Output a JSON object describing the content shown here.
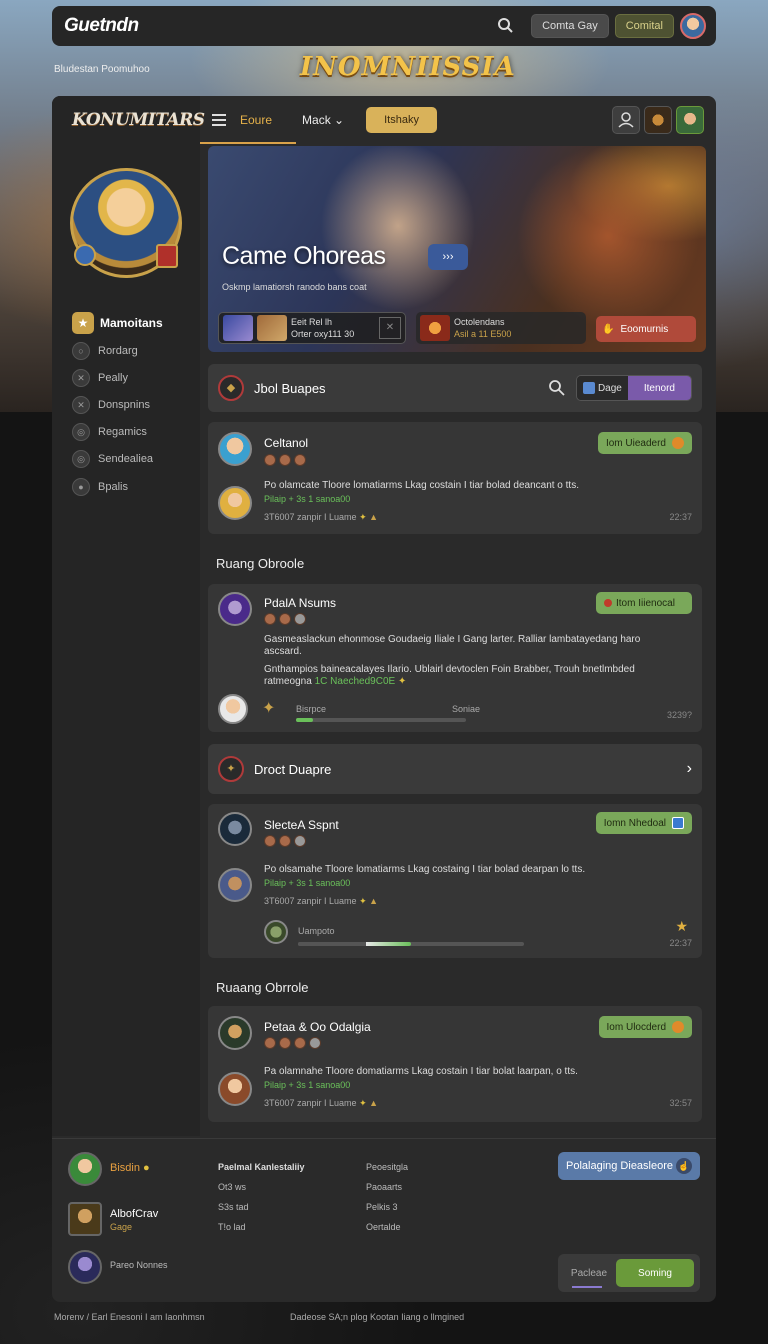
{
  "topbar": {
    "logo": "Guetndn",
    "btn1": "Comta Gay",
    "btn2": "Comital"
  },
  "banner": {
    "subtitle": "Bludestan Poomuhoo",
    "game_title": "INOMNIISSIA"
  },
  "sidebar": {
    "logo": "KONUMITARS",
    "header": "Mamoitans",
    "items": [
      {
        "label": "Rordarg"
      },
      {
        "label": "Peally"
      },
      {
        "label": "Donspnins"
      },
      {
        "label": "Regamics"
      },
      {
        "label": "Sendealiea"
      },
      {
        "label": "Bpalis"
      }
    ]
  },
  "header": {
    "tab1": "Eoure",
    "tab2": "Mack",
    "tab3": "Itshaky"
  },
  "hero": {
    "title": "Came Ohoreas",
    "arrow": "›››",
    "subtitle": "Oskmp lamatiorsh   ranodo bans coat",
    "card1_line1": "Eeit Rel lh",
    "card1_line2": "Orter oxy111 30",
    "card2_line1": "Octolendans",
    "card2_line2": "Asil a 11 E500",
    "button": "Eoomurnis"
  },
  "bar1": {
    "label": "Jbol Buapes",
    "toggle_a": "Dage",
    "toggle_b": "Itenord"
  },
  "card1": {
    "name": "Celtanol",
    "badge": "Iom Uieaderd",
    "text": "Po olamcate Tloore lomatiarms Lkag costain I tiar bolad deancant o tts.",
    "green": "Pilaip + 3s 1 sanoa00",
    "meta": "3T6007  zanpir I Luame",
    "time": "22:37"
  },
  "section1": "Ruang Obroole",
  "card2": {
    "name": "PdalA Nsums",
    "badge": "Itom Iiienocal",
    "text1": "Gasmeaslackun ehonmose Goudaeig Iliale I Gang larter. Ralliar lambatayedang haro",
    "text1b": "ascsard.",
    "text2": "Gnthampios baineacalayes Ilario. Ublairl devtoclen Foin Brabber, Trouh bnetlmbded",
    "text2_prefix": "ratmeogna",
    "green": "1C Naeched9C0E",
    "progress_label": "Bisrpce",
    "progress_right": "Soniae",
    "progress": 0.1,
    "time": "3239?"
  },
  "bar2": {
    "label": "Droct Duapre"
  },
  "card3": {
    "name": "SlecteA Sspnt",
    "badge": "Iomn Nhedoal",
    "text": "Po olsamahe Tloore lomatiarms Lkag costaing I tiar bolad dearpan lo tts.",
    "green": "Pilaip + 3s 1 sanoa00",
    "meta": "3T6007  zanpir I Luame",
    "progress_label": "Uampoto",
    "progress": 0.5,
    "time": "22:37"
  },
  "section2": "Ruaang Obrrole",
  "card4": {
    "name": "Petaa & Oo Odalgia",
    "badge": "Iom Ulocderd",
    "text": "Pa olamnahe Tloore domatiarms Lkag costain I tiar bolat laarpan, o tts.",
    "green": "Pilaip + 3s 1 sanoa00",
    "meta": "3T6007  zanpir I Luame",
    "time": "32:57"
  },
  "footer": {
    "user1": "Bisdin",
    "user2": "AlbofCrav",
    "user2_sub": "Gage",
    "user3": "Pareo Nonnes",
    "col1_title": "Paelmal Kanlestaliiy",
    "col1": [
      "Ot3 ws",
      "S3s tad",
      "T!o lad"
    ],
    "col2": [
      "Peoesitgla",
      "Paoaarts",
      "Pelkis 3",
      "Oertalde"
    ],
    "btn": "Polalaging Dieasleore",
    "toggle_a": "Pacleae",
    "toggle_b": "Soming"
  },
  "bottom": {
    "left": "Morenv / Earl Enesoni I am Iaonhmsn",
    "right": "Dadeose SA;n plog Kootan Iiang o llmgined"
  }
}
